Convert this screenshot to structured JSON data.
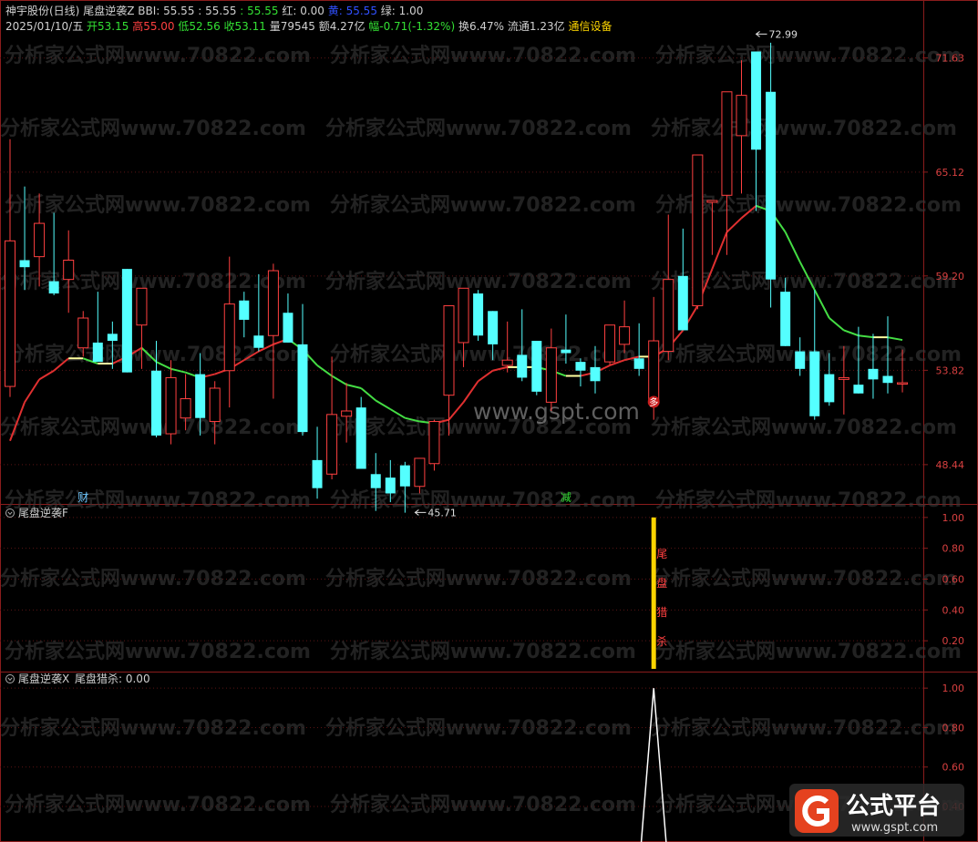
{
  "header": {
    "line1": [
      {
        "text": "神宇股份(日线)",
        "color": "#d0d0d0"
      },
      {
        "text": " 尾盘逆袭Z",
        "color": "#d0d0d0"
      },
      {
        "text": " BBI: 55.55",
        "color": "#d0d0d0"
      },
      {
        "text": " : 55.55",
        "color": "#d0d0d0"
      },
      {
        "text": " : 55.55",
        "color": "#33e033"
      },
      {
        "text": " 红: 0.00",
        "color": "#d0d0d0"
      },
      {
        "text": " 黄: 55.55",
        "color": "#3050ff"
      },
      {
        "text": " 绿: 1.00",
        "color": "#d0d0d0"
      }
    ],
    "line2": [
      {
        "text": "2025/01/10/五",
        "color": "#d0d0d0"
      },
      {
        "text": " 开53.15",
        "color": "#33e033"
      },
      {
        "text": " 高55.00",
        "color": "#ff4040"
      },
      {
        "text": " 低52.56",
        "color": "#33e033"
      },
      {
        "text": " 收53.11",
        "color": "#33e033"
      },
      {
        "text": " 量79545",
        "color": "#d0d0d0"
      },
      {
        "text": " 额4.27亿",
        "color": "#d0d0d0"
      },
      {
        "text": " 幅-0.71(-1.32%)",
        "color": "#33e033"
      },
      {
        "text": " 换6.47%",
        "color": "#d0d0d0"
      },
      {
        "text": " 流通1.23亿",
        "color": "#d0d0d0"
      },
      {
        "text": " 通信设备",
        "color": "#ffd700"
      }
    ]
  },
  "panels": {
    "main": {
      "yticks": [
        "71.63",
        "65.12",
        "59.20",
        "53.82",
        "48.44"
      ],
      "high_marker": "72.99",
      "low_marker": "45.71",
      "markers": [
        {
          "text": "财",
          "index": 5,
          "color": "#6ec8ff"
        },
        {
          "text": "减",
          "index": 38,
          "color": "#33e033"
        },
        {
          "text": "多",
          "index": 44,
          "color": "#ff3030"
        }
      ]
    },
    "f": {
      "title": "尾盘逆袭F",
      "yticks": [
        "1.00",
        "0.80",
        "0.60",
        "0.40",
        "0.20"
      ],
      "signal_label": [
        "尾",
        "盘",
        "猎",
        "杀"
      ]
    },
    "x": {
      "title": "尾盘逆袭X",
      "value_label": "尾盘猎杀: 0.00",
      "yticks": [
        "1.00",
        "0.80",
        "0.60",
        "0.40"
      ]
    }
  },
  "watermarks": {
    "text": "分析家公式网www.70822.com",
    "site": "www.gspt.com",
    "logo_text": "公式平台",
    "logo_url": "www.gspt.com"
  },
  "colors": {
    "up": "#ff4040",
    "down": "#54ffff",
    "bbi_up": "#e03030",
    "bbi_down": "#44dd44",
    "bbi_flat": "#ffffa0"
  },
  "chart_data": [
    {
      "type": "candlestick",
      "title": "神宇股份(日线)",
      "ylim": [
        46.2,
        74.0
      ],
      "candles": [
        {
          "o": 52.9,
          "h": 67.0,
          "l": 52.3,
          "c": 61.2
        },
        {
          "o": 60.1,
          "h": 64.3,
          "l": 58.4,
          "c": 59.7
        },
        {
          "o": 60.3,
          "h": 63.9,
          "l": 58.6,
          "c": 62.2
        },
        {
          "o": 58.9,
          "h": 62.8,
          "l": 58.1,
          "c": 58.2
        },
        {
          "o": 59.0,
          "h": 61.8,
          "l": 57.1,
          "c": 60.1
        },
        {
          "o": 55.1,
          "h": 57.2,
          "l": 54.6,
          "c": 56.8
        },
        {
          "o": 55.4,
          "h": 58.3,
          "l": 54.6,
          "c": 54.3
        },
        {
          "o": 55.9,
          "h": 56.6,
          "l": 53.9,
          "c": 55.5
        },
        {
          "o": 59.6,
          "h": 59.6,
          "l": 53.8,
          "c": 53.7
        },
        {
          "o": 56.4,
          "h": 57.6,
          "l": 53.9,
          "c": 58.5
        },
        {
          "o": 53.8,
          "h": 55.5,
          "l": 50.0,
          "c": 50.1
        },
        {
          "o": 50.2,
          "h": 54.4,
          "l": 49.6,
          "c": 53.4
        },
        {
          "o": 51.1,
          "h": 53.6,
          "l": 50.4,
          "c": 52.2
        },
        {
          "o": 53.6,
          "h": 54.8,
          "l": 50.1,
          "c": 51.1
        },
        {
          "o": 50.9,
          "h": 53.2,
          "l": 49.6,
          "c": 52.8
        },
        {
          "o": 53.8,
          "h": 60.3,
          "l": 51.7,
          "c": 57.6
        },
        {
          "o": 57.8,
          "h": 58.3,
          "l": 55.7,
          "c": 56.7
        },
        {
          "o": 55.8,
          "h": 59.3,
          "l": 54.9,
          "c": 55.1
        },
        {
          "o": 55.8,
          "h": 59.9,
          "l": 52.2,
          "c": 59.5
        },
        {
          "o": 57.1,
          "h": 58.2,
          "l": 55.9,
          "c": 55.4
        },
        {
          "o": 55.3,
          "h": 57.6,
          "l": 50.1,
          "c": 50.3
        },
        {
          "o": 48.7,
          "h": 50.6,
          "l": 46.5,
          "c": 47.1
        },
        {
          "o": 47.9,
          "h": 54.6,
          "l": 47.6,
          "c": 51.3
        },
        {
          "o": 51.2,
          "h": 53.1,
          "l": 49.7,
          "c": 51.5
        },
        {
          "o": 51.7,
          "h": 52.3,
          "l": 48.6,
          "c": 48.2
        },
        {
          "o": 47.9,
          "h": 49.1,
          "l": 45.8,
          "c": 47.1
        },
        {
          "o": 47.7,
          "h": 48.7,
          "l": 46.3,
          "c": 46.8
        },
        {
          "o": 48.4,
          "h": 48.6,
          "l": 45.7,
          "c": 47.2
        },
        {
          "o": 47.2,
          "h": 48.4,
          "l": 46.8,
          "c": 48.8
        },
        {
          "o": 48.5,
          "h": 51.0,
          "l": 48.1,
          "c": 50.9
        },
        {
          "o": 52.4,
          "h": 56.8,
          "l": 50.1,
          "c": 57.5
        },
        {
          "o": 55.4,
          "h": 57.8,
          "l": 54.0,
          "c": 58.5
        },
        {
          "o": 58.2,
          "h": 58.4,
          "l": 55.5,
          "c": 55.8
        },
        {
          "o": 57.2,
          "h": 57.2,
          "l": 54.4,
          "c": 55.3
        },
        {
          "o": 54.1,
          "h": 56.6,
          "l": 53.7,
          "c": 54.4
        },
        {
          "o": 54.7,
          "h": 57.3,
          "l": 53.2,
          "c": 53.4
        },
        {
          "o": 55.5,
          "h": 55.2,
          "l": 52.4,
          "c": 52.6
        },
        {
          "o": 52.0,
          "h": 56.2,
          "l": 51.5,
          "c": 55.1
        },
        {
          "o": 55.0,
          "h": 57.0,
          "l": 54.2,
          "c": 54.8
        },
        {
          "o": 54.3,
          "h": 54.5,
          "l": 52.9,
          "c": 53.8
        },
        {
          "o": 54.0,
          "h": 55.2,
          "l": 52.5,
          "c": 53.2
        },
        {
          "o": 54.3,
          "h": 56.3,
          "l": 54.1,
          "c": 56.4
        },
        {
          "o": 55.3,
          "h": 57.8,
          "l": 54.8,
          "c": 56.3
        },
        {
          "o": 54.5,
          "h": 56.5,
          "l": 53.5,
          "c": 53.9
        },
        {
          "o": 52.0,
          "h": 58.0,
          "l": 51.0,
          "c": 55.5
        },
        {
          "o": 54.9,
          "h": 62.7,
          "l": 54.4,
          "c": 59.0
        },
        {
          "o": 59.2,
          "h": 61.9,
          "l": 56.2,
          "c": 56.1
        },
        {
          "o": 57.5,
          "h": 61.8,
          "l": 57.3,
          "c": 66.1
        },
        {
          "o": 63.4,
          "h": 61.9,
          "l": 60.4,
          "c": 63.5
        },
        {
          "o": 63.8,
          "h": 68.2,
          "l": 60.4,
          "c": 69.7
        },
        {
          "o": 67.2,
          "h": 71.5,
          "l": 63.9,
          "c": 69.5
        },
        {
          "o": 72.0,
          "h": 72.0,
          "l": 62.9,
          "c": 66.4
        },
        {
          "o": 69.7,
          "h": 72.5,
          "l": 57.4,
          "c": 59.0
        },
        {
          "o": 58.3,
          "h": 59.1,
          "l": 56.1,
          "c": 55.2
        },
        {
          "o": 54.9,
          "h": 55.7,
          "l": 53.5,
          "c": 53.9
        },
        {
          "o": 54.9,
          "h": 58.4,
          "l": 51.0,
          "c": 51.2
        },
        {
          "o": 53.6,
          "h": 54.8,
          "l": 51.8,
          "c": 52.0
        },
        {
          "o": 53.3,
          "h": 55.2,
          "l": 51.3,
          "c": 53.4
        },
        {
          "o": 53.0,
          "h": 56.3,
          "l": 52.6,
          "c": 52.5
        },
        {
          "o": 53.9,
          "h": 55.9,
          "l": 52.2,
          "c": 53.3
        },
        {
          "o": 53.5,
          "h": 56.9,
          "l": 52.5,
          "c": 53.1
        },
        {
          "o": 53.1,
          "h": 55.0,
          "l": 52.56,
          "c": 53.11
        }
      ],
      "bbi": [
        49.8,
        52.0,
        53.3,
        53.8,
        54.5,
        54.5,
        54.2,
        54.2,
        54.6,
        55.1,
        54.3,
        53.9,
        53.7,
        53.4,
        53.6,
        53.9,
        54.4,
        54.9,
        55.3,
        55.6,
        55.0,
        54.1,
        53.5,
        53.0,
        52.8,
        52.1,
        51.6,
        51.1,
        50.9,
        50.8,
        51.0,
        52.0,
        53.2,
        53.8,
        54.0,
        54.0,
        54.0,
        53.8,
        53.5,
        53.5,
        53.7,
        54.1,
        54.4,
        54.6,
        54.6,
        55.1,
        56.1,
        57.5,
        59.6,
        61.7,
        62.5,
        63.2,
        62.9,
        61.7,
        60.0,
        58.4,
        56.8,
        56.1,
        55.8,
        55.7,
        55.7,
        55.55
      ],
      "high": 72.99,
      "low": 45.71
    },
    {
      "type": "bar",
      "title": "尾盘逆袭F",
      "ylim": [
        0,
        1.07
      ],
      "signal_index": 44,
      "value": 1.0
    },
    {
      "type": "line",
      "title": "尾盘逆袭X",
      "series": [
        {
          "name": "尾盘猎杀",
          "signal_index": 44,
          "peak": 1.0,
          "last": 0.0
        }
      ],
      "ylim": [
        0.22,
        1.07
      ]
    }
  ]
}
